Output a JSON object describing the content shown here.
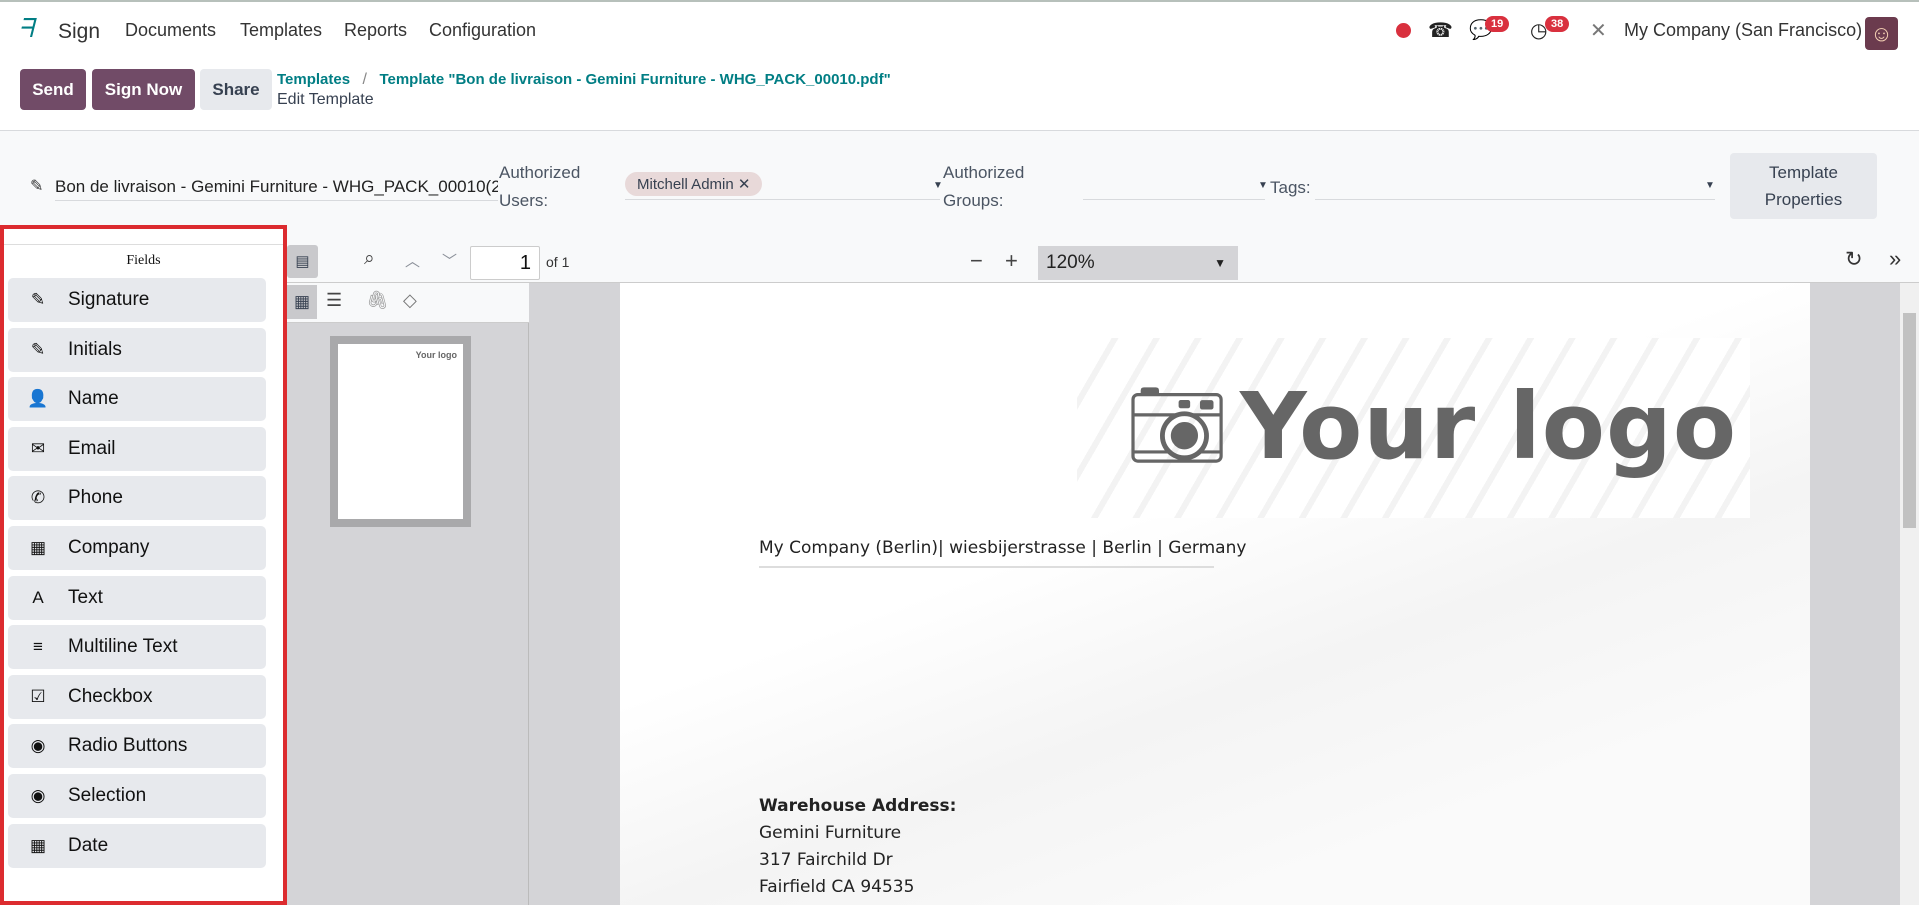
{
  "nav": {
    "app": "Sign",
    "items": [
      "Documents",
      "Templates",
      "Reports",
      "Configuration"
    ],
    "messages_count": "19",
    "activities_count": "38",
    "company": "My Company (San Francisco)"
  },
  "actions": {
    "send": "Send",
    "sign_now": "Sign Now",
    "share": "Share"
  },
  "breadcrumb": {
    "parent": "Templates",
    "separator": "/",
    "current": "Template \"Bon de livraison - Gemini Furniture - WHG_PACK_00010.pdf\"",
    "sub": "Edit Template"
  },
  "template": {
    "name": "Bon de livraison - Gemini Furniture - WHG_PACK_00010(2",
    "authorized_users_label": "Authorized Users:",
    "authorized_users_tag": "Mitchell Admin",
    "authorized_groups_label": "Authorized Groups:",
    "tags_label": "Tags:",
    "properties_button": "Template Properties"
  },
  "fields": {
    "title": "Fields",
    "items": [
      {
        "label": "Signature",
        "icon": "✎"
      },
      {
        "label": "Initials",
        "icon": "✎"
      },
      {
        "label": "Name",
        "icon": "👤"
      },
      {
        "label": "Email",
        "icon": "✉"
      },
      {
        "label": "Phone",
        "icon": "✆"
      },
      {
        "label": "Company",
        "icon": "▦"
      },
      {
        "label": "Text",
        "icon": "A"
      },
      {
        "label": "Multiline Text",
        "icon": "≡"
      },
      {
        "label": "Checkbox",
        "icon": "☑"
      },
      {
        "label": "Radio Buttons",
        "icon": "◉"
      },
      {
        "label": "Selection",
        "icon": "◉"
      },
      {
        "label": "Date",
        "icon": "▦"
      }
    ]
  },
  "viewer": {
    "page": "1",
    "of": "of 1",
    "zoom": "120%"
  },
  "document": {
    "logo": "Your logo",
    "company_line": "My Company (Berlin)| wiesbijerstrasse | Berlin | Germany",
    "warehouse_label": "Warehouse Address:",
    "address": [
      "Gemini Furniture",
      "317 Fairchild Dr",
      "Fairfield CA 94535"
    ]
  },
  "colors": {
    "primary": "#714b67",
    "link": "#017e84",
    "highlight": "#dc2b2f"
  }
}
